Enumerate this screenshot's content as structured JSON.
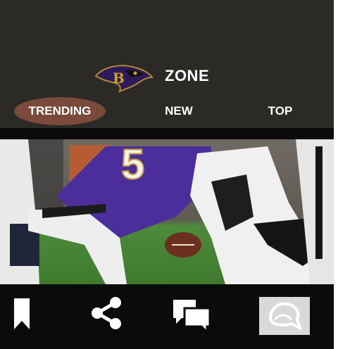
{
  "header": {
    "title": "ZONE",
    "logo": "ravens-logo"
  },
  "tabs": [
    {
      "label": "TRENDING",
      "active": true
    },
    {
      "label": "NEW",
      "active": false
    },
    {
      "label": "TOP",
      "active": false
    }
  ],
  "photo": {
    "description_icon": "football-photo",
    "jersey_number": "5"
  },
  "toolbar": {
    "icons": [
      "bookmark-icon",
      "share-icon",
      "comments-icon",
      "chat-bubble-icon"
    ]
  },
  "colors": {
    "header_bg": "#2b2a26",
    "active_tab": "#7a4a3a",
    "bar_bg": "#0b0b0b",
    "purple_jersey": "#4b2e9c",
    "field_green": "#4d8a3a"
  }
}
